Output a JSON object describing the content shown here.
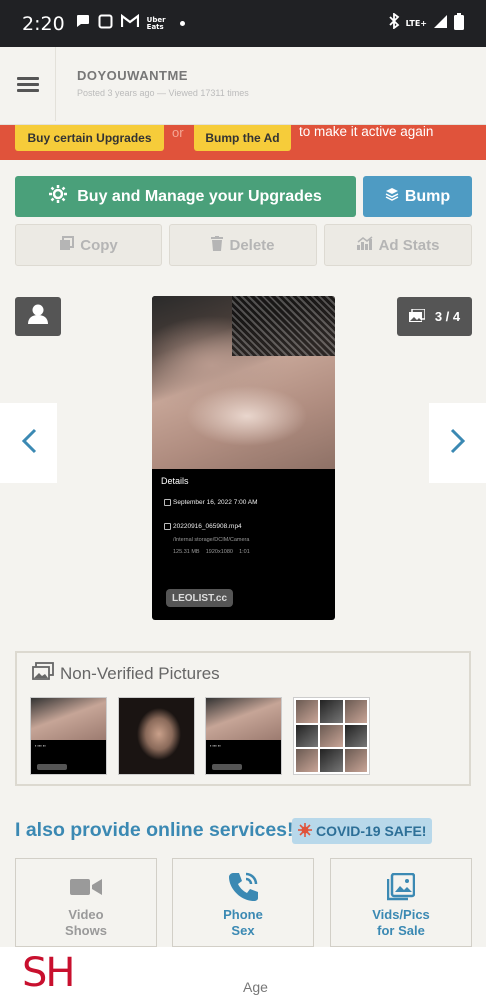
{
  "status_bar": {
    "time": "2:20",
    "uber_line1": "Uber",
    "uber_line2": "Eats",
    "network": "LTE+"
  },
  "header": {
    "title": "DOYOUWANTME",
    "subtitle": "Posted 3 years ago — Viewed 17311 times"
  },
  "alert": {
    "upgrades_label": "Buy certain Upgrades",
    "or_text": "or",
    "bump_label": "Bump the Ad",
    "tail_text": "to make it active again"
  },
  "actions": {
    "upgrades": "Buy and Manage your Upgrades",
    "bump": "Bump",
    "copy": "Copy",
    "delete": "Delete",
    "stats": "Ad Stats"
  },
  "gallery": {
    "counter": "3 / 4",
    "details": {
      "title": "Details",
      "date": "September 16, 2022 7:00 AM",
      "filename": "20220916_065908.mp4",
      "path": "/Internal storage/DCIM/Camera",
      "size": "125.31 MB",
      "resolution": "1920x1080",
      "duration": "1:01"
    },
    "watermark": "LEOLIST.cc"
  },
  "nonverified": {
    "title": "Non-Verified Pictures"
  },
  "services": {
    "heading": "I also provide online services!",
    "covid_badge": "COVID-19 SAFE!",
    "items": [
      {
        "line1": "Video",
        "line2": "Shows"
      },
      {
        "line1": "Phone",
        "line2": "Sex"
      },
      {
        "line1": "Vids/Pics",
        "line2": "for Sale"
      }
    ]
  },
  "footer": {
    "logo": "SH",
    "age_label": "Age"
  },
  "colors": {
    "green": "#4aa07a",
    "blue": "#4e9bc3",
    "alert_red": "#e0533b",
    "alert_yellow": "#f6cc3a",
    "heading_blue": "#3b89b3",
    "logo_red": "#c8102e"
  }
}
